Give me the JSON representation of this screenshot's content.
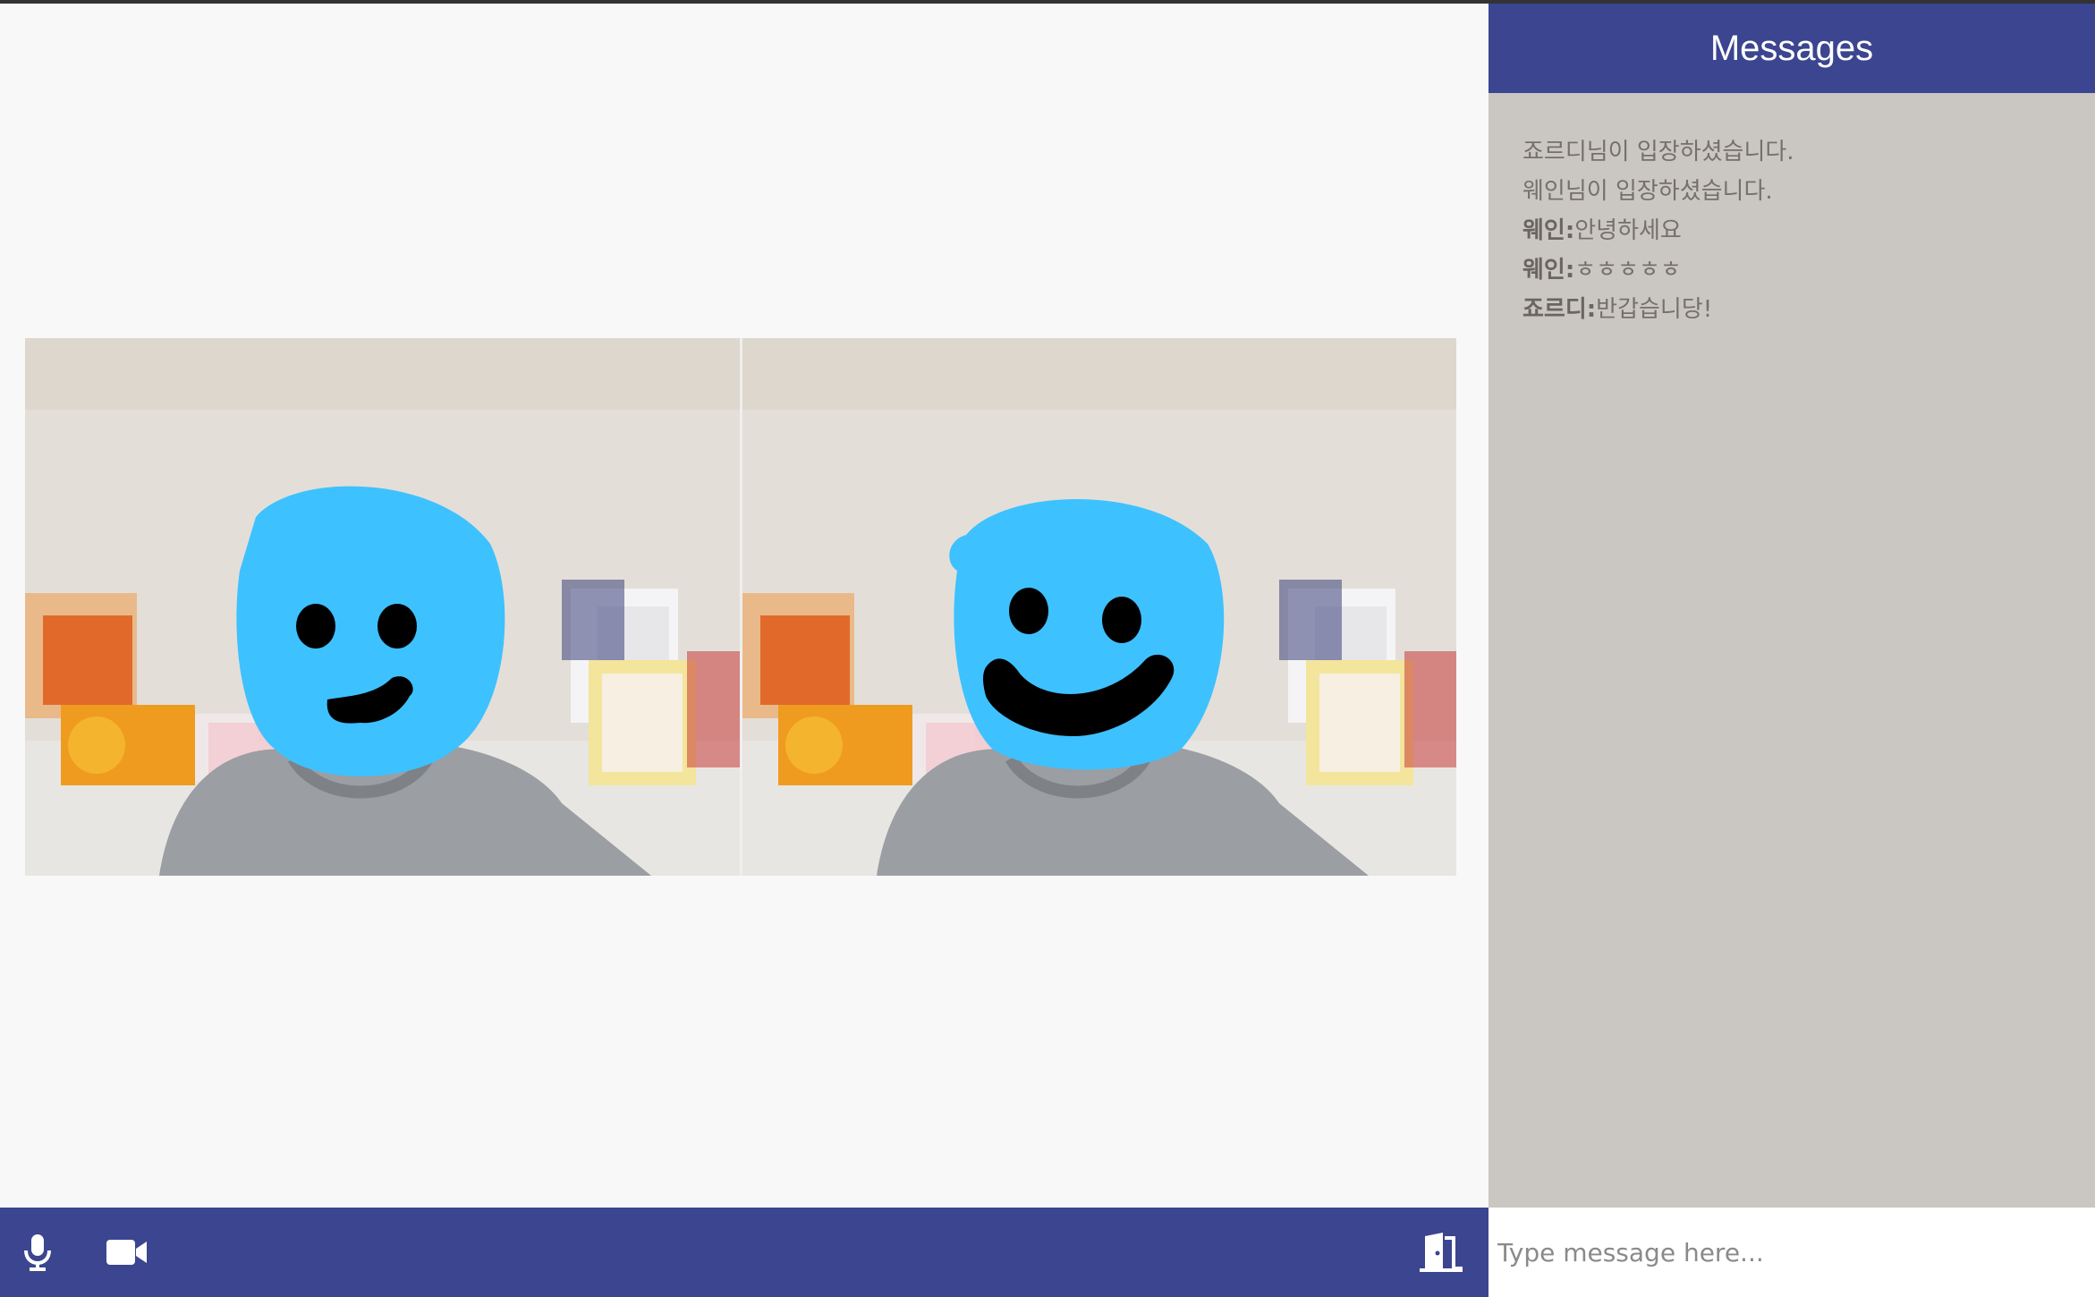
{
  "chat": {
    "title": "Messages",
    "messages": [
      {
        "sender": "",
        "text": "죠르디님이 입장하셨습니다."
      },
      {
        "sender": "",
        "text": "웨인님이 입장하셨습니다."
      },
      {
        "sender": "웨인:",
        "text": "안녕하세요"
      },
      {
        "sender": "웨인:",
        "text": "ㅎㅎㅎㅎㅎ"
      },
      {
        "sender": "죠르디:",
        "text": "반갑습니당!"
      }
    ],
    "input_placeholder": "Type message here..."
  },
  "toolbar": {
    "mic_icon": "microphone-icon",
    "camera_icon": "video-camera-icon",
    "leave_icon": "door-exit-icon"
  },
  "videos": [
    {
      "name": "video-tile-1"
    },
    {
      "name": "video-tile-2"
    }
  ],
  "colors": {
    "accent": "#3b4590",
    "chat_background": "#cac7c3",
    "main_background": "#f8f8f8",
    "face_mask": "#3ec1ff"
  }
}
